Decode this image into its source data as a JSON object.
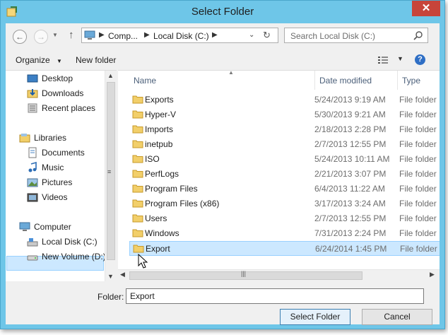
{
  "window": {
    "title": "Select Folder",
    "close_label": "✕"
  },
  "nav": {
    "address": {
      "segments": [
        "Comp...",
        "Local Disk (C:)"
      ]
    },
    "search": {
      "placeholder": "Search Local Disk (C:)"
    }
  },
  "toolbar": {
    "organize_label": "Organize",
    "new_folder_label": "New folder"
  },
  "sidebar": {
    "items": [
      {
        "label": "Desktop",
        "icon": "desktop-icon"
      },
      {
        "label": "Downloads",
        "icon": "downloads-icon"
      },
      {
        "label": "Recent places",
        "icon": "recent-places-icon"
      },
      {
        "label": "Libraries",
        "icon": "libraries-icon"
      },
      {
        "label": "Documents",
        "icon": "documents-icon"
      },
      {
        "label": "Music",
        "icon": "music-icon"
      },
      {
        "label": "Pictures",
        "icon": "pictures-icon"
      },
      {
        "label": "Videos",
        "icon": "videos-icon"
      },
      {
        "label": "Computer",
        "icon": "computer-icon"
      },
      {
        "label": "Local Disk (C:)",
        "icon": "drive-icon",
        "selected": true
      },
      {
        "label": "New Volume (D:)",
        "icon": "drive-icon"
      }
    ]
  },
  "filelist": {
    "columns": {
      "name": "Name",
      "date": "Date modified",
      "type": "Type"
    },
    "rows": [
      {
        "name": "Exports",
        "date": "5/24/2013 9:19 AM",
        "type": "File folder"
      },
      {
        "name": "Hyper-V",
        "date": "5/30/2013 9:21 AM",
        "type": "File folder"
      },
      {
        "name": "Imports",
        "date": "2/18/2013 2:28 PM",
        "type": "File folder"
      },
      {
        "name": "inetpub",
        "date": "2/7/2013 12:55 PM",
        "type": "File folder"
      },
      {
        "name": "ISO",
        "date": "5/24/2013 10:11 AM",
        "type": "File folder"
      },
      {
        "name": "PerfLogs",
        "date": "2/21/2013 3:07 PM",
        "type": "File folder"
      },
      {
        "name": "Program Files",
        "date": "6/4/2013 11:22 AM",
        "type": "File folder"
      },
      {
        "name": "Program Files (x86)",
        "date": "3/17/2013 3:24 AM",
        "type": "File folder"
      },
      {
        "name": "Users",
        "date": "2/7/2013 12:55 PM",
        "type": "File folder"
      },
      {
        "name": "Windows",
        "date": "7/31/2013 2:24 PM",
        "type": "File folder"
      },
      {
        "name": "Export",
        "date": "6/24/2014 1:45 PM",
        "type": "File folder",
        "selected": true
      }
    ]
  },
  "footer": {
    "folder_label": "Folder:",
    "folder_value": "Export",
    "select_label": "Select Folder",
    "cancel_label": "Cancel"
  },
  "colors": {
    "title_bar": "#6ec6e8",
    "selection": "#cce8ff",
    "close": "#c7443a"
  }
}
